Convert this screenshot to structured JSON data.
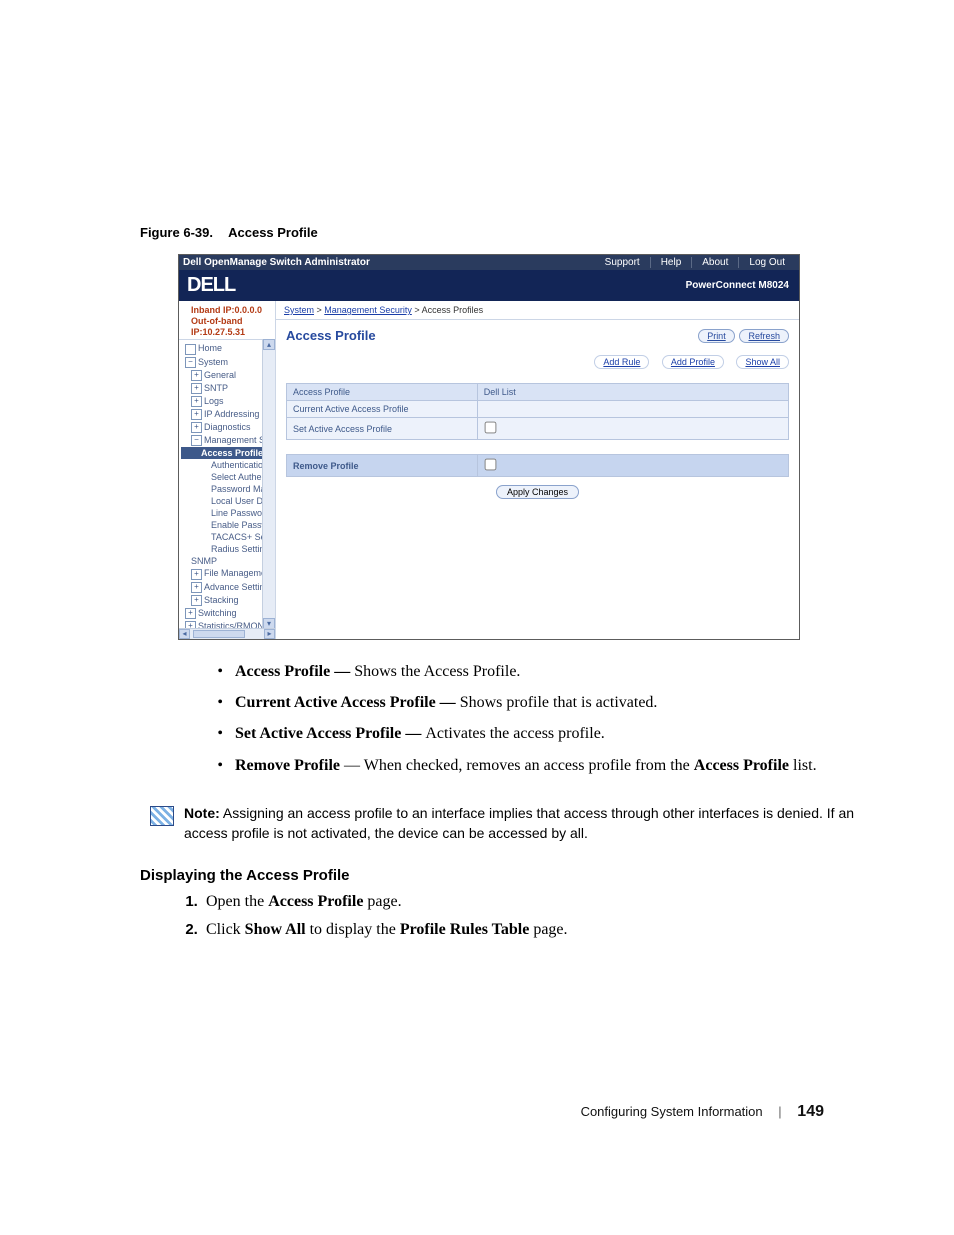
{
  "figure": {
    "number": "Figure 6-39.",
    "title": "Access Profile"
  },
  "shot": {
    "titlebar": {
      "title": "Dell OpenManage Switch Administrator",
      "links": [
        "Support",
        "Help",
        "About",
        "Log Out"
      ]
    },
    "brand": {
      "logo": "DELL",
      "model": "PowerConnect M8024"
    },
    "ip": {
      "inband": "Inband IP:0.0.0.0",
      "outband": "Out-of-band IP:10.27.5.31"
    },
    "tree": [
      {
        "label": "Home",
        "depth": 0,
        "icon": ""
      },
      {
        "label": "System",
        "depth": 0,
        "icon": "−"
      },
      {
        "label": "General",
        "depth": 1,
        "icon": "+"
      },
      {
        "label": "SNTP",
        "depth": 1,
        "icon": "+"
      },
      {
        "label": "Logs",
        "depth": 1,
        "icon": "+"
      },
      {
        "label": "IP Addressing",
        "depth": 1,
        "icon": "+"
      },
      {
        "label": "Diagnostics",
        "depth": 1,
        "icon": "+"
      },
      {
        "label": "Management Secur",
        "depth": 1,
        "icon": "−"
      },
      {
        "label": "Access Profiles",
        "depth": 2,
        "cur": true
      },
      {
        "label": "Authentication Pr",
        "depth": 3
      },
      {
        "label": "Select Authentic",
        "depth": 3
      },
      {
        "label": "Password Manag",
        "depth": 3
      },
      {
        "label": "Local User Datab",
        "depth": 3
      },
      {
        "label": "Line Password",
        "depth": 3
      },
      {
        "label": "Enable Password",
        "depth": 3
      },
      {
        "label": "TACACS+ Settin",
        "depth": 3
      },
      {
        "label": "Radius Settings",
        "depth": 3
      },
      {
        "label": "SNMP",
        "depth": 1
      },
      {
        "label": "File Management",
        "depth": 1,
        "icon": "+"
      },
      {
        "label": "Advance Settings",
        "depth": 1,
        "icon": "+"
      },
      {
        "label": "Stacking",
        "depth": 1,
        "icon": "+"
      },
      {
        "label": "Switching",
        "depth": 0,
        "icon": "+"
      },
      {
        "label": "Statistics/RMON",
        "depth": 0,
        "icon": "+"
      }
    ],
    "crumbs": {
      "root": "System",
      "mid": "Management Security",
      "leaf": "Access Profiles"
    },
    "panel": {
      "title": "Access Profile",
      "buttons": {
        "print": "Print",
        "refresh": "Refresh"
      },
      "links": {
        "addRule": "Add Rule",
        "addProfile": "Add Profile",
        "showAll": "Show All"
      },
      "rows": {
        "hdr_col1": "Access Profile",
        "hdr_col2": "Dell List",
        "r1_col1": "Current Active Access Profile",
        "r2_col1": "Set Active Access Profile",
        "remove": "Remove Profile"
      },
      "apply": "Apply Changes"
    }
  },
  "bullets": [
    {
      "term": "Access Profile — ",
      "desc": "Shows the Access Profile."
    },
    {
      "term": "Current Active Access Profile — ",
      "desc": "Shows profile that is activated."
    },
    {
      "term": "Set Active Access Profile — ",
      "desc": "Activates the access profile."
    },
    {
      "term_plain": "Remove Profile",
      "desc_pre": " — When checked, removes an access profile from the ",
      "desc_bold": "Access Profile",
      "desc_post": " list."
    }
  ],
  "note": {
    "label": "Note:",
    "text": " Assigning an access profile to an interface implies that access through other interfaces is denied. If an access profile is not activated, the device can be accessed by all."
  },
  "subheading": "Displaying the Access Profile",
  "steps": {
    "s1_a": "Open the ",
    "s1_b": "Access Profile",
    "s1_c": " page.",
    "s2_a": "Click ",
    "s2_b": "Show All",
    "s2_c": " to display the ",
    "s2_d": "Profile Rules Table",
    "s2_e": " page."
  },
  "footer": {
    "section": "Configuring System Information",
    "page": "149"
  }
}
